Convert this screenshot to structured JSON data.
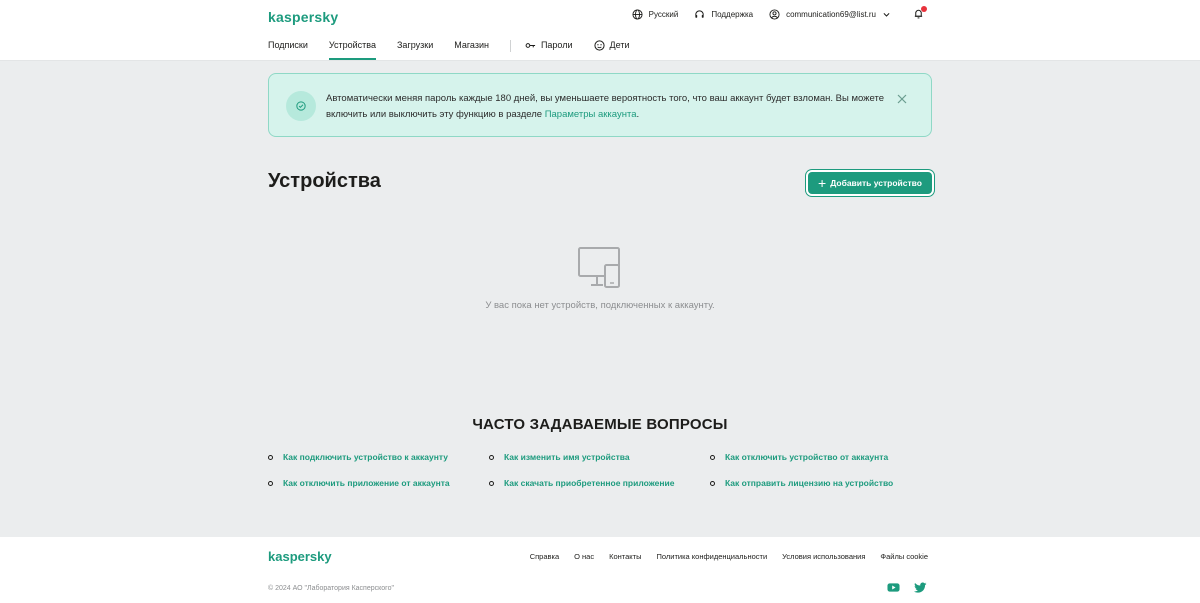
{
  "header": {
    "logo": "kaspersky",
    "language": "Русский",
    "support": "Поддержка",
    "account_email": "communication69@list.ru"
  },
  "nav": {
    "items": [
      {
        "label": "Подписки"
      },
      {
        "label": "Устройства",
        "active": true
      },
      {
        "label": "Загрузки"
      },
      {
        "label": "Магазин"
      }
    ],
    "extra": [
      {
        "label": "Пароли"
      },
      {
        "label": "Дети"
      }
    ]
  },
  "alert": {
    "text": "Автоматически меняя пароль каждые 180 дней, вы уменьшаете вероятность того, что ваш аккаунт будет взломан. Вы можете включить или выключить эту функцию в разделе ",
    "link": "Параметры аккаунта",
    "suffix": "."
  },
  "devices": {
    "title": "Устройства",
    "add_button": "Добавить устройство",
    "empty_text": "У вас пока нет устройств, подключенных к аккаунту."
  },
  "faq": {
    "title": "ЧАСТО ЗАДАВАЕМЫЕ ВОПРОСЫ",
    "links": [
      "Как подключить устройство к аккаунту",
      "Как изменить имя устройства",
      "Как отключить устройство от аккаунта",
      "Как отключить приложение от аккаунта",
      "Как скачать приобретенное приложение",
      "Как отправить лицензию на устройство"
    ]
  },
  "footer": {
    "logo": "kaspersky",
    "links": [
      "Справка",
      "О нас",
      "Контакты",
      "Политика конфиденциальности",
      "Условия использования",
      "Файлы cookie"
    ],
    "copyright": "© 2024 АО \"Лаборатория Касперского\""
  },
  "colors": {
    "brand": "#1d9b7e",
    "alert_bg": "#d6f3ec",
    "page_bg": "#ebedee"
  },
  "icons": [
    "globe-icon",
    "headset-icon",
    "user-icon",
    "chevron-down-icon",
    "bell-icon",
    "key-icon",
    "kids-icon",
    "check-circle-icon",
    "close-icon",
    "plus-icon",
    "devices-icon",
    "youtube-icon",
    "twitter-icon"
  ]
}
